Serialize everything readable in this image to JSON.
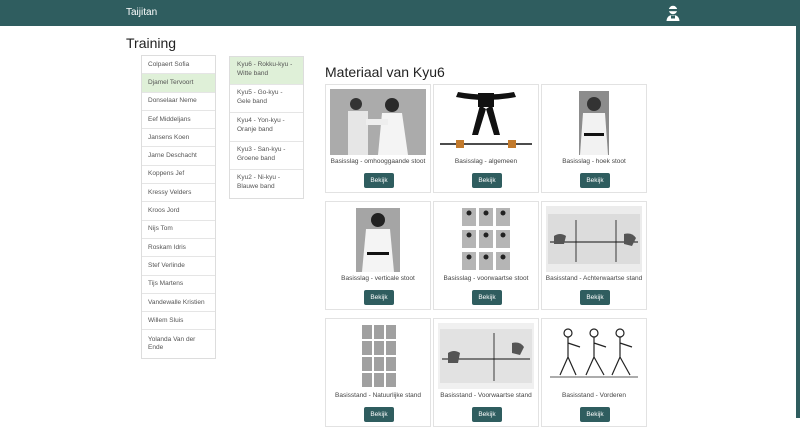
{
  "navbar": {
    "brand": "Taijitan",
    "user_icon": "user-ninja-icon"
  },
  "page": {
    "title": "Training"
  },
  "students": [
    "Colpaert Sofia",
    "Djamel Tervoort",
    "Donselaar Neme",
    "Eef Middeljans",
    "Jansens Koen",
    "Jarne Deschacht",
    "Koppens Jef",
    "Kressy Velders",
    "Kroos Jord",
    "Nijs Tom",
    "Roskam Idris",
    "Stef Verlinde",
    "Tijs Martens",
    "Vandewalle Kristien",
    "Willem Sluis",
    "Yolanda Van der Ende"
  ],
  "active_student": "Djamel Tervoort",
  "levels": [
    "Kyu6 - Rokku-kyu - Witte band",
    "Kyu5 - Go-kyu - Gele band",
    "Kyu4 - Yon-kyu - Oranje band",
    "Kyu3 - San-kyu - Groene band",
    "Kyu2 - Ni-kyu - Blauwe band"
  ],
  "active_level": "Kyu6 - Rokku-kyu - Witte band",
  "materials": {
    "title": "Materiaal van Kyu6",
    "button_label": "Bekijk",
    "items": [
      {
        "caption": "Basisslag - omhooggaande stoot",
        "image": "photo-two-fighters"
      },
      {
        "caption": "Basisslag - algemeen",
        "image": "belt-diagram"
      },
      {
        "caption": "Basisslag - hoek stoot",
        "image": "photo-master"
      },
      {
        "caption": "Basisslag - verticale stoot",
        "image": "photo-fighter"
      },
      {
        "caption": "Basisslag - voorwaartse stoot",
        "image": "photo-grid"
      },
      {
        "caption": "Basisstand - Achterwaartse stand",
        "image": "stance-diagram"
      },
      {
        "caption": "Basisstand - Natuurlijke stand",
        "image": "photo-column"
      },
      {
        "caption": "Basisstand - Voorwaartse stand",
        "image": "stance-diagram-2"
      },
      {
        "caption": "Basisstand - Vorderen",
        "image": "stepping-sketch"
      }
    ]
  }
}
